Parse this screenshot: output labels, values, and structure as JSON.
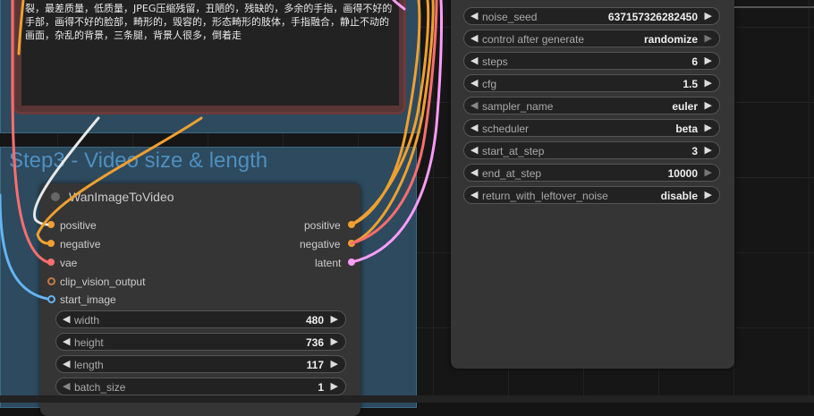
{
  "prompt": {
    "text": "裂，最差质量，低质量，JPEG压缩残留，丑陋的，残缺的，多余的手指，画得不好的手部，画得不好的脸部，畸形的，毁容的，形态畸形的肢体，手指融合，静止不动的画面，杂乱的背景，三条腿，背景人很多，倒着走"
  },
  "group": {
    "title": "Step3 - Video size & length"
  },
  "node": {
    "title": "WanImageToVideo",
    "inputs": [
      "positive",
      "negative",
      "vae",
      "clip_vision_output",
      "start_image"
    ],
    "outputs": [
      "positive",
      "negative",
      "latent"
    ],
    "widgets": [
      {
        "name": "width",
        "value": "480"
      },
      {
        "name": "height",
        "value": "736"
      },
      {
        "name": "length",
        "value": "117"
      },
      {
        "name": "batch_size",
        "value": "1"
      }
    ]
  },
  "sampler": {
    "widgets": [
      {
        "name": "noise_seed",
        "value": "637157326282450"
      },
      {
        "name": "control after generate",
        "value": "randomize"
      },
      {
        "name": "steps",
        "value": "6"
      },
      {
        "name": "cfg",
        "value": "1.5"
      },
      {
        "name": "sampler_name",
        "value": "euler"
      },
      {
        "name": "scheduler",
        "value": "beta"
      },
      {
        "name": "start_at_step",
        "value": "3"
      },
      {
        "name": "end_at_step",
        "value": "10000"
      },
      {
        "name": "return_with_leftover_noise",
        "value": "disable"
      }
    ]
  },
  "colors": {
    "conditioning": "#f0a030",
    "vae": "#ff6e6e",
    "clip_vision": "#a0522d",
    "image": "#64b5f6",
    "latent": "#ff9cf9",
    "group": "#2d4a5e"
  }
}
